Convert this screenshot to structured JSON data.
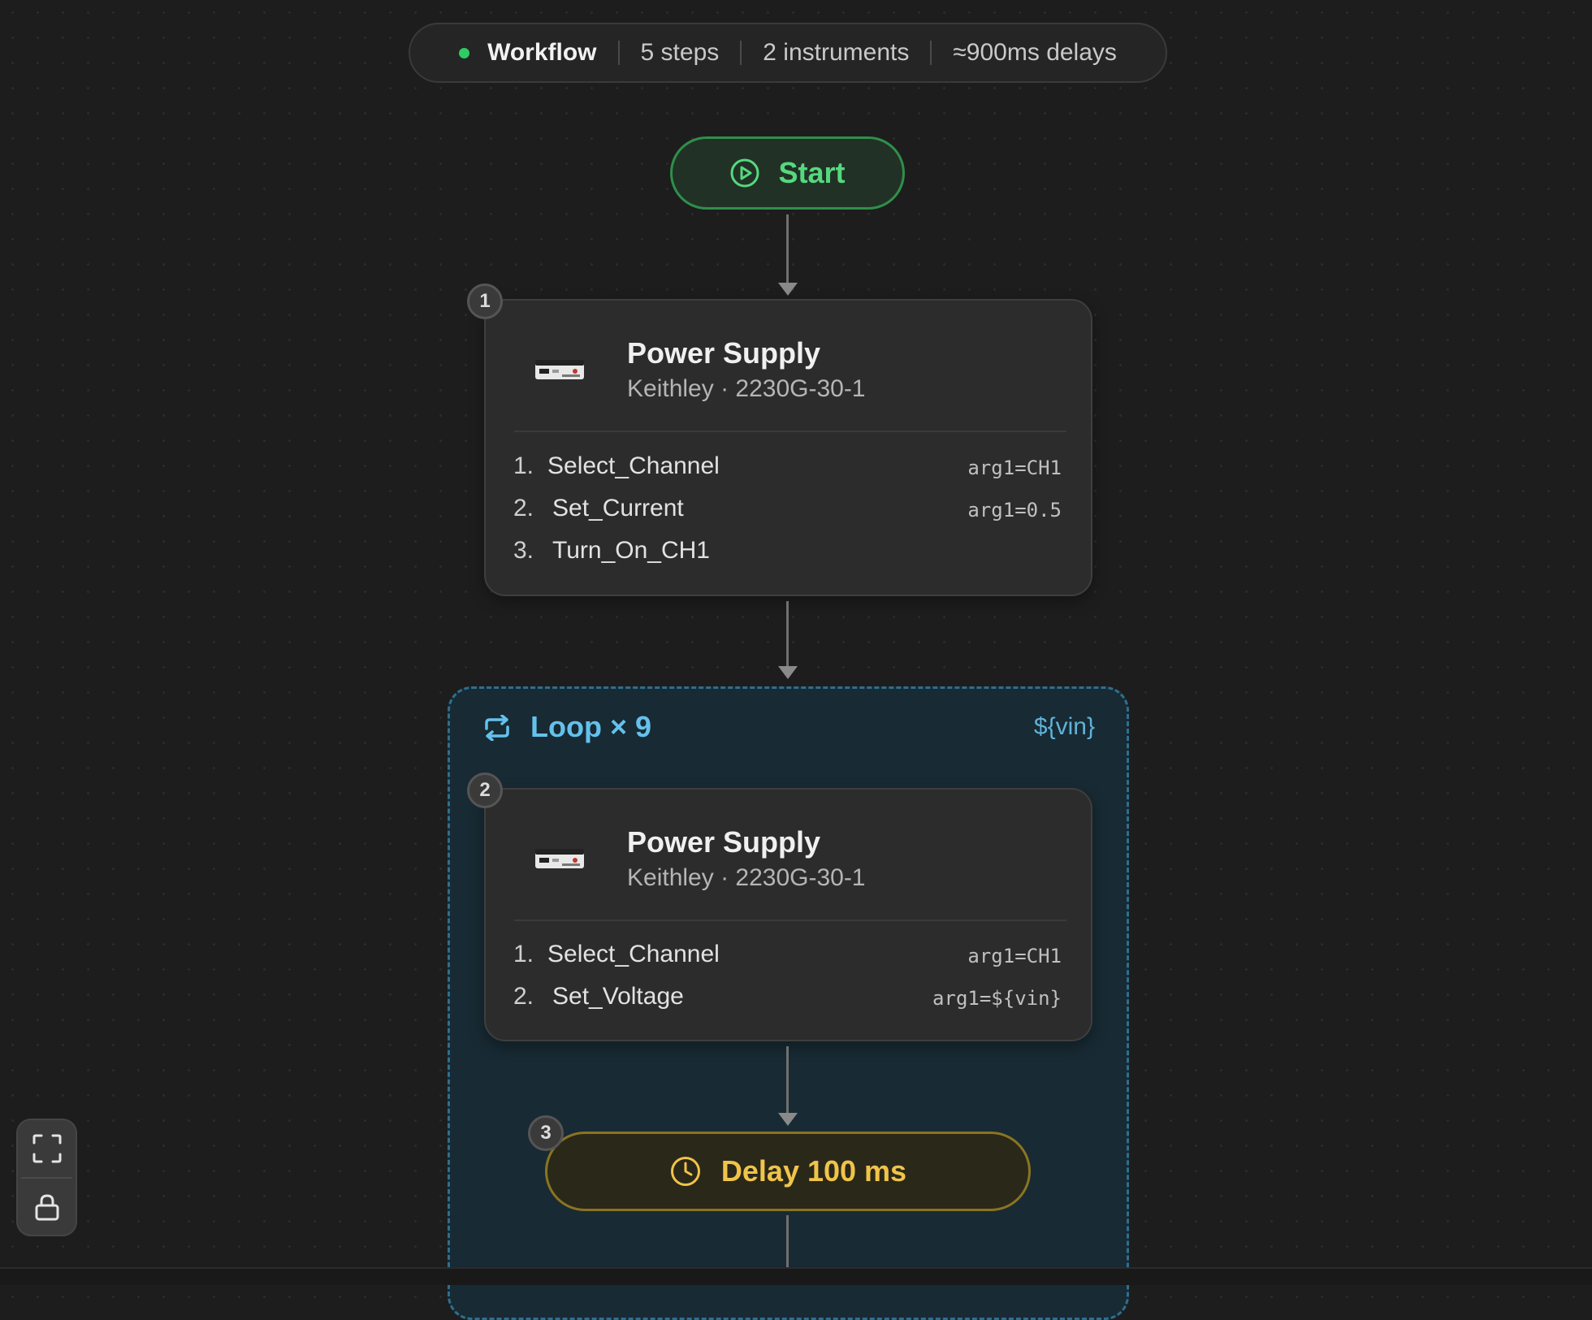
{
  "summary": {
    "title": "Workflow",
    "steps": "5 steps",
    "instruments": "2 instruments",
    "delays": "≈900ms delays",
    "status_color": "#2ecc63"
  },
  "start": {
    "label": "Start",
    "icon": "play-circle-icon"
  },
  "steps": [
    {
      "badge": "1",
      "title": "Power Supply",
      "subtitle": "Keithley · 2230G-30-1",
      "commands": [
        {
          "num": "1.",
          "name": "Select_Channel",
          "arg": "arg1=CH1"
        },
        {
          "num": "2.",
          "name": "Set_Current",
          "arg": "arg1=0.5"
        },
        {
          "num": "3.",
          "name": "Turn_On_CH1",
          "arg": ""
        }
      ]
    },
    {
      "badge": "2",
      "title": "Power Supply",
      "subtitle": "Keithley · 2230G-30-1",
      "commands": [
        {
          "num": "1.",
          "name": "Select_Channel",
          "arg": "arg1=CH1"
        },
        {
          "num": "2.",
          "name": "Set_Voltage",
          "arg": "arg1=${vin}"
        }
      ]
    }
  ],
  "loop": {
    "label": "Loop × 9",
    "variable": "${vin}",
    "icon": "repeat-icon",
    "accent": "#64c1ec"
  },
  "delay": {
    "badge": "3",
    "label": "Delay 100 ms",
    "icon": "clock-icon",
    "accent": "#f0c34a"
  },
  "controls": {
    "fit_icon": "fit-view-icon",
    "lock_icon": "lock-icon"
  }
}
